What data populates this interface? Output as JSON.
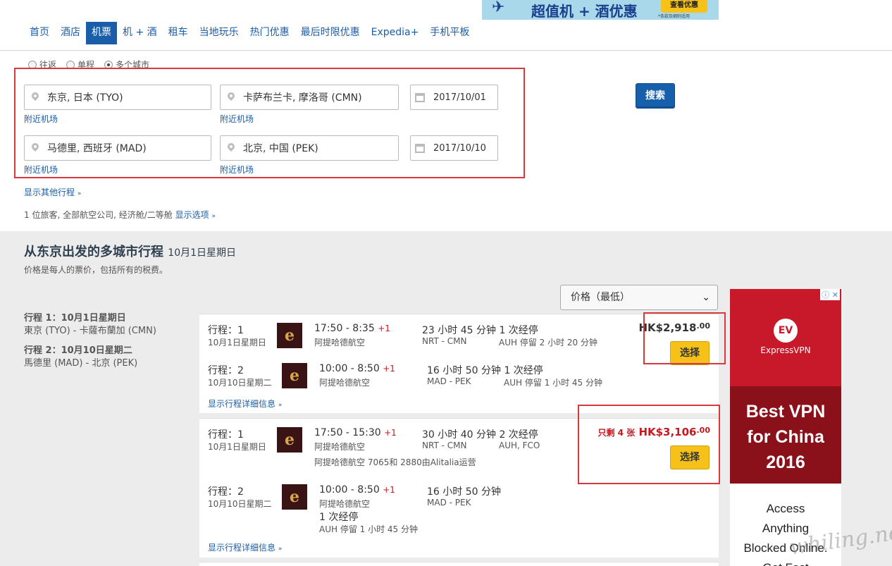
{
  "banner": {
    "text": "超值机 + 酒优惠",
    "button": "查看优惠",
    "note": "*条款及细则适用"
  },
  "nav": {
    "items": [
      "首页",
      "酒店",
      "机票",
      "机 + 酒",
      "租车",
      "当地玩乐",
      "热门优惠",
      "最后时限优惠",
      "Expedia+",
      "手机平板"
    ],
    "active_index": 2
  },
  "trip_types": {
    "options": [
      "往返",
      "单程",
      "多个城市"
    ],
    "selected": "多个城市"
  },
  "search": {
    "legs": [
      {
        "from": "东京, 日本 (TYO)",
        "to": "卡萨布兰卡, 摩洛哥 (CMN)",
        "date": "2017/10/01",
        "from_nearby": "附近机场",
        "to_nearby": "附近机场"
      },
      {
        "from": "马德里, 西班牙 (MAD)",
        "to": "北京, 中国 (PEK)",
        "date": "2017/10/10",
        "from_nearby": "附近机场",
        "to_nearby": "附近机场"
      }
    ],
    "button": "搜索",
    "show_more_legs": "显示其他行程",
    "travelers_summary": "1 位旅客, 全部航空公司, 经济舱/二等舱",
    "show_options": "显示选项"
  },
  "results": {
    "title": "从东京出发的多城市行程",
    "title_date": "10月1日星期日",
    "price_note": "价格是每人的票价，包括所有的税费。",
    "sort_label": "价格（最低）",
    "summary": [
      {
        "label": "行程 1：10月1日星期日",
        "route": "東京 (TYO) - 卡薩布蘭加 (CMN)"
      },
      {
        "label": "行程 2：10月10日星期二",
        "route": "馬德里 (MAD) - 北京 (PEK)"
      }
    ],
    "cards": [
      {
        "price": "HK$2,918",
        "cents": ".00",
        "seats_left": "",
        "select": "选择",
        "details_link": "显示行程详细信息",
        "legs": [
          {
            "label": "行程：1",
            "date": "10月1日星期日",
            "time": "17:50 - 8:35",
            "plus": "+1",
            "airline": "阿提哈德航空",
            "duration": "23 小时 45 分钟",
            "stops": "1 次经停",
            "codes": "NRT - CMN",
            "stop_info": "AUH 停留 2 小时 20 分钟"
          },
          {
            "label": "行程：2",
            "date": "10月10日星期二",
            "time": "10:00 - 8:50",
            "plus": "+1",
            "airline": "阿提哈德航空",
            "duration": "16 小时 50 分钟",
            "stops": "1 次经停",
            "codes": "MAD - PEK",
            "stop_info": "AUH 停留 1 小时 45 分钟"
          }
        ]
      },
      {
        "price": "HK$3,106",
        "cents": ".00",
        "seats_left": "只剩 4 张",
        "select": "选择",
        "details_link": "显示行程详细信息",
        "operated_note": "阿提哈德航空 7065和 2880由Alitalia运营",
        "legs": [
          {
            "label": "行程：1",
            "date": "10月1日星期日",
            "time": "17:50 - 15:30",
            "plus": "+1",
            "airline": "阿提哈德航空",
            "duration": "30 小时 40 分钟",
            "stops": "2 次经停",
            "codes": "NRT - CMN",
            "stop_info": "AUH, FCO"
          },
          {
            "label": "行程：2",
            "date": "10月10日星期二",
            "time": "10:00 - 8:50",
            "plus": "+1",
            "airline": "阿提哈德航空",
            "duration": "16 小时 50 分钟",
            "stops": "1 次经停",
            "codes": "MAD - PEK",
            "stop_info": "AUH 停留 1 小时 45 分钟"
          }
        ]
      }
    ]
  },
  "ad": {
    "brand": "ExpressVPN",
    "logo_text": "EV",
    "headline_lines": [
      "Best VPN",
      "for China",
      "2016"
    ],
    "body_lines": [
      "Access",
      "Anything",
      "Blocked Online.",
      "Get Fast"
    ]
  },
  "watermark": "whiling.net",
  "colors": {
    "link": "#1a5da8",
    "accent_red": "#c8171e",
    "select_yellow": "#f6c21a",
    "annotation_red": "#d9383e"
  }
}
